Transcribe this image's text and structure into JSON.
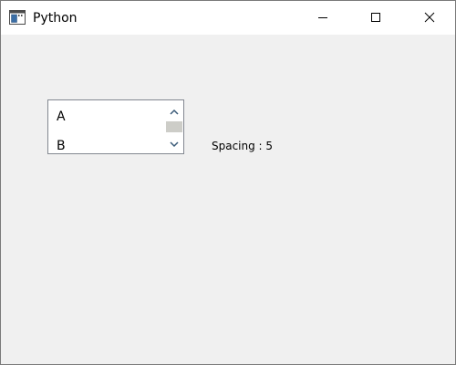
{
  "window": {
    "title": "Python",
    "icon": "python-window-icon"
  },
  "controls": {
    "minimize_icon": "minimize-icon",
    "maximize_icon": "maximize-icon",
    "close_icon": "close-icon"
  },
  "listbox": {
    "items": [
      "A",
      "B"
    ],
    "scroll_up_icon": "chevron-up-icon",
    "scroll_down_icon": "chevron-down-icon"
  },
  "spacing_label": "Spacing : 5",
  "colors": {
    "window_bg": "#f0f0f0",
    "titlebar_bg": "#ffffff",
    "list_border": "#828790",
    "scroll_thumb": "#cdcdc8"
  }
}
